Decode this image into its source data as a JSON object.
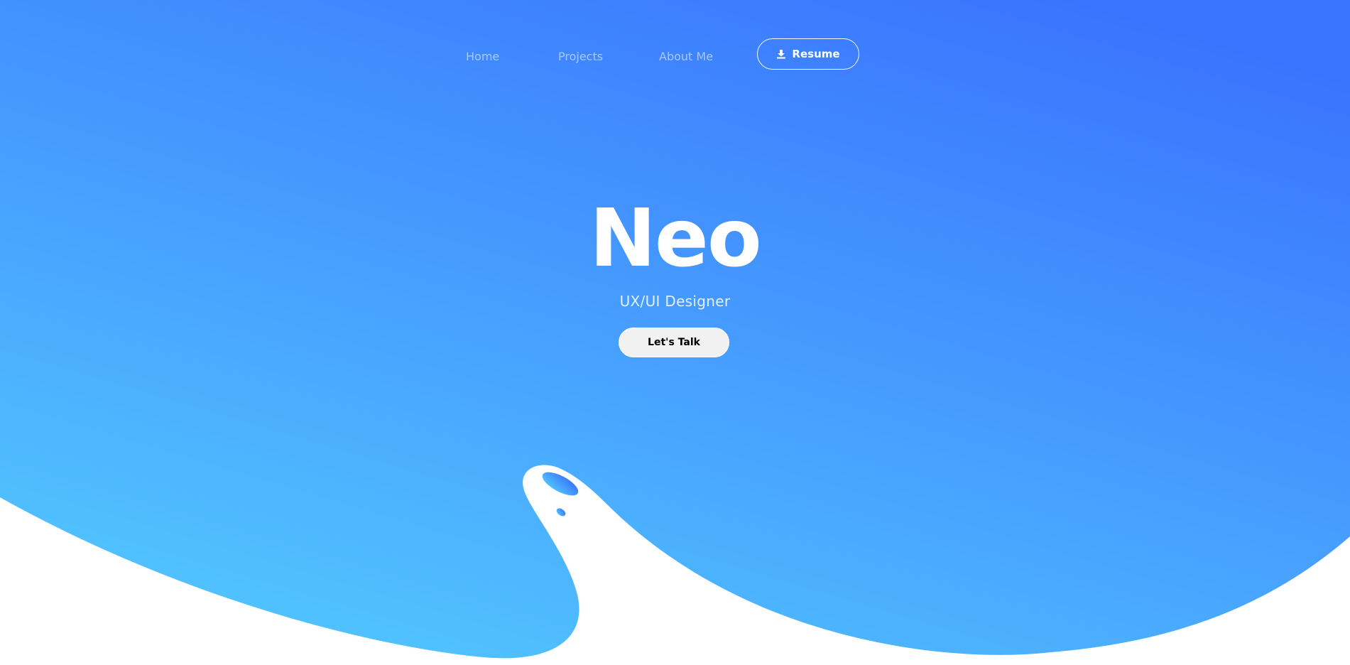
{
  "colors": {
    "gradient_top": "#3a74fe",
    "gradient_bottom": "#52c6fe",
    "wave": "#ffffff",
    "button_bg": "#f1f1f1"
  },
  "nav": {
    "links": [
      {
        "label": "Home"
      },
      {
        "label": "Projects"
      },
      {
        "label": "About Me"
      }
    ],
    "resume": {
      "label": "Resume",
      "icon": "download-icon"
    }
  },
  "hero": {
    "title": "Neo",
    "subtitle": "UX/UI Designer",
    "cta_label": "Let's Talk"
  }
}
